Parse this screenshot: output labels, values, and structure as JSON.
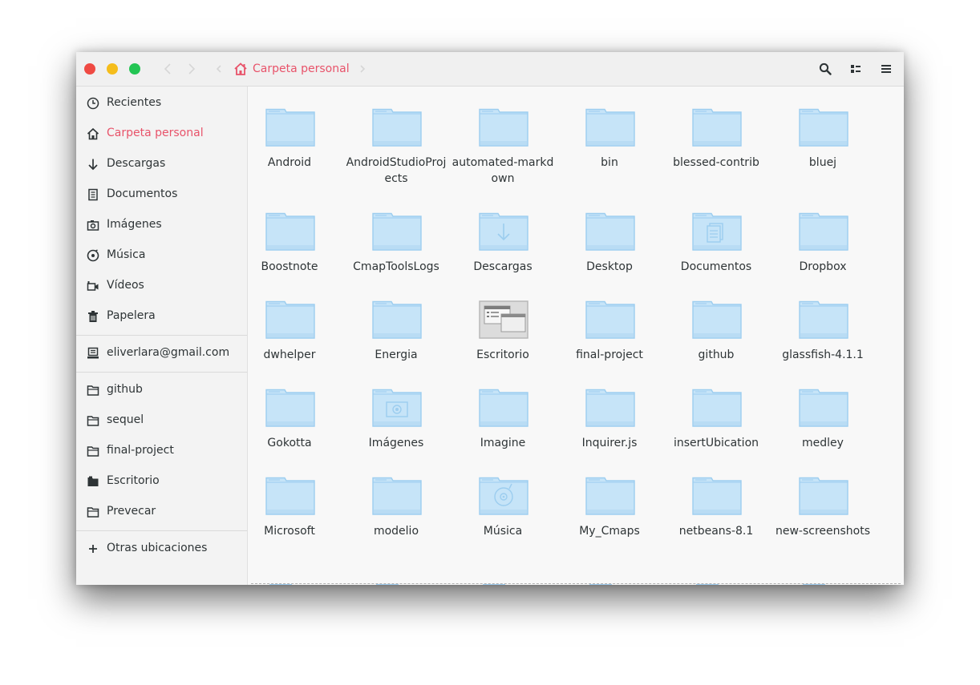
{
  "window": {
    "path_label": "Carpeta personal"
  },
  "header_icons": [
    "search-icon",
    "view-list-icon",
    "hamburger-menu-icon"
  ],
  "sidebar": {
    "places": [
      {
        "label": "Recientes",
        "icon": "clock-icon"
      },
      {
        "label": "Carpeta personal",
        "icon": "home-icon",
        "active": true
      },
      {
        "label": "Descargas",
        "icon": "download-arrow-icon"
      },
      {
        "label": "Documentos",
        "icon": "document-icon"
      },
      {
        "label": "Imágenes",
        "icon": "camera-icon"
      },
      {
        "label": "Música",
        "icon": "music-disc-icon"
      },
      {
        "label": "Vídeos",
        "icon": "video-camera-icon"
      },
      {
        "label": "Papelera",
        "icon": "trash-icon"
      }
    ],
    "account": {
      "label": "eliverlara@gmail.com",
      "icon": "computer-icon"
    },
    "bookmarks": [
      {
        "label": "github",
        "icon": "folder-outline-icon"
      },
      {
        "label": "sequel",
        "icon": "folder-outline-icon"
      },
      {
        "label": "final-project",
        "icon": "folder-outline-icon"
      },
      {
        "label": "Escritorio",
        "icon": "folder-filled-icon"
      },
      {
        "label": "Prevecar",
        "icon": "folder-outline-icon"
      }
    ],
    "other": {
      "label": "Otras ubicaciones",
      "icon": "plus-icon"
    }
  },
  "files": [
    {
      "name": "Android",
      "type": "folder"
    },
    {
      "name": "AndroidStudioProjects",
      "type": "folder"
    },
    {
      "name": "automated-markdown",
      "type": "folder"
    },
    {
      "name": "bin",
      "type": "folder"
    },
    {
      "name": "blessed-contrib",
      "type": "folder"
    },
    {
      "name": "bluej",
      "type": "folder"
    },
    {
      "name": "Boostnote",
      "type": "folder"
    },
    {
      "name": "CmapToolsLogs",
      "type": "folder"
    },
    {
      "name": "Descargas",
      "type": "downloads"
    },
    {
      "name": "Desktop",
      "type": "folder"
    },
    {
      "name": "Documentos",
      "type": "documents"
    },
    {
      "name": "Dropbox",
      "type": "folder"
    },
    {
      "name": "dwhelper",
      "type": "folder"
    },
    {
      "name": "Energia",
      "type": "folder"
    },
    {
      "name": "Escritorio",
      "type": "desktop"
    },
    {
      "name": "final-project",
      "type": "folder"
    },
    {
      "name": "github",
      "type": "folder"
    },
    {
      "name": "glassfish-4.1.1",
      "type": "folder"
    },
    {
      "name": "Gokotta",
      "type": "folder"
    },
    {
      "name": "Imágenes",
      "type": "pictures"
    },
    {
      "name": "Imagine",
      "type": "folder"
    },
    {
      "name": "Inquirer.js",
      "type": "folder"
    },
    {
      "name": "insertUbication",
      "type": "folder"
    },
    {
      "name": "medley",
      "type": "folder"
    },
    {
      "name": "Microsoft",
      "type": "folder"
    },
    {
      "name": "modelio",
      "type": "folder"
    },
    {
      "name": "Música",
      "type": "music"
    },
    {
      "name": "My_Cmaps",
      "type": "folder"
    },
    {
      "name": "netbeans-8.1",
      "type": "folder"
    },
    {
      "name": "new-screenshots",
      "type": "folder"
    }
  ],
  "colors": {
    "accent": "#e8536a",
    "folder_fill": "#c6e4f8",
    "folder_stroke": "#9ccdef"
  }
}
